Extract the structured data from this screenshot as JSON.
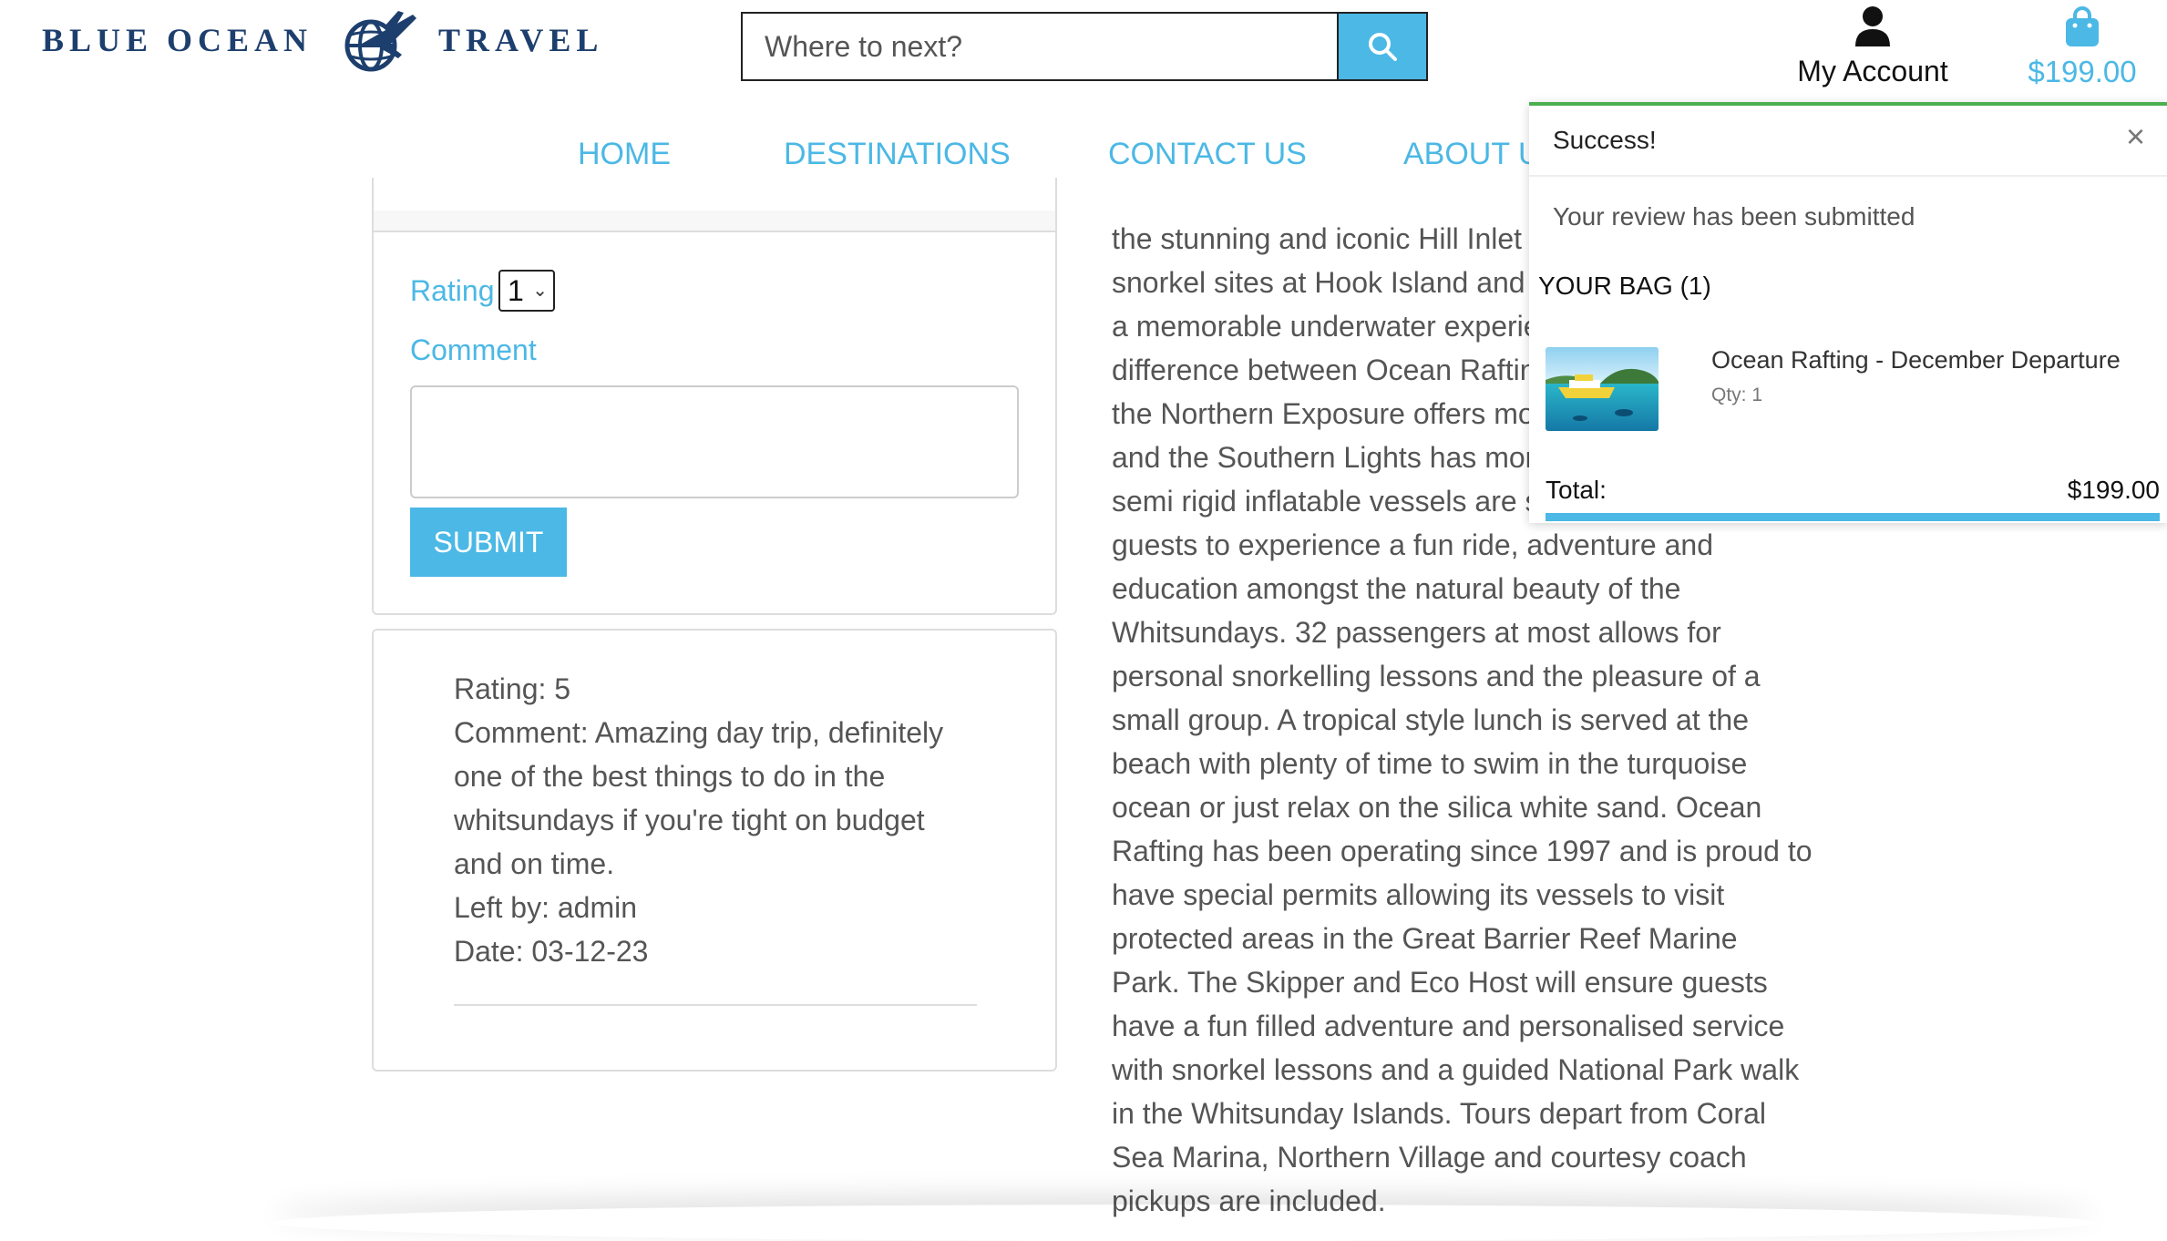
{
  "header": {
    "logo_left": "BLUE OCEAN",
    "logo_right": "TRAVEL",
    "search_placeholder": "Where to next?",
    "account_label": "My Account",
    "bag_total": "$199.00"
  },
  "nav": {
    "items": [
      "HOME",
      "DESTINATIONS",
      "CONTACT US",
      "ABOUT U"
    ]
  },
  "review_form": {
    "rating_label": "Rating",
    "rating_value": "1",
    "comment_label": "Comment",
    "submit_label": "SUBMIT"
  },
  "review": {
    "rating": "Rating: 5",
    "comment_lines": [
      "Comment: Amazing day trip, definitely",
      "one of the best things to do in the",
      "whitsundays if you're tight on budget",
      "and on time."
    ],
    "left_by": "Left by: admin",
    "date": "Date: 03-12-23"
  },
  "description": {
    "lines": [
      "the stunning and iconic Hill Inlet l",
      "snorkel sites at Hook Island and E",
      "a memorable underwater experie",
      "difference between Ocean Raftin",
      "the Northern Exposure offers mo",
      "and the Southern Lights has more",
      "semi rigid inflatable vessels are su",
      "guests to experience a fun ride, adventure and",
      "education amongst the natural beauty of the",
      "Whitsundays. 32 passengers at most allows for",
      "personal snorkelling lessons and the pleasure of a",
      "small group. A tropical style lunch is served at the",
      "beach with plenty of time to swim in the turquoise",
      "ocean or just relax on the silica white sand. Ocean",
      "Rafting has been operating since 1997 and is proud to",
      "have special permits allowing its vessels to visit",
      "protected areas in the Great Barrier Reef Marine",
      "Park. The Skipper and Eco Host will ensure guests",
      "have a fun filled adventure and personalised service",
      "with snorkel lessons and a guided National Park walk",
      "in the Whitsunday Islands. Tours depart from Coral",
      "Sea Marina, Northern Village and courtesy coach",
      "pickups are included."
    ]
  },
  "toast": {
    "title": "Success!",
    "close_glyph": "×",
    "message": "Your review has been submitted",
    "bag_heading": "YOUR BAG (1)",
    "item_name": "Ocean Rafting - December Departure",
    "item_qty": "Qty: 1",
    "total_label": "Total:",
    "total_value": "$199.00",
    "progress_fraction": 1.0
  },
  "colors": {
    "accent": "#4bb8e5",
    "logo_navy": "#1d3f6e",
    "success_green": "#4caf50",
    "body_text": "#555555"
  },
  "icons": {
    "search": "search-icon",
    "account": "user-icon",
    "bag": "shopping-bag-icon",
    "close": "close-icon",
    "logo": "globe-plane-icon"
  }
}
